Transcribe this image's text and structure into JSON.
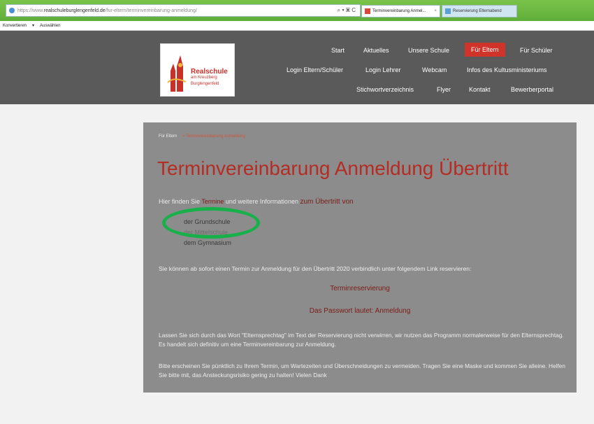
{
  "browser": {
    "url_prefix": "https://www.",
    "url_domain": "realschuleburglengenfeld.de",
    "url_path": "/fur-eltern/terminvereinbarung-anmeldung/",
    "url_tools": "⌕ ▾ ▣ C",
    "tabs": [
      {
        "label": "Terminvereinbarung Anmel...",
        "close": "×"
      },
      {
        "label": "Reservierung Elternabend"
      }
    ],
    "favbar": [
      "Konvertieren",
      "▾",
      "Auswählen"
    ]
  },
  "logo": {
    "line1": "Realschule",
    "line2": "am Kreuzberg",
    "line3": "Burglengenfeld"
  },
  "nav": {
    "row1": [
      "Start",
      "Aktuelles",
      "Unsere Schule",
      "Für Eltern",
      "Für Schüler"
    ],
    "row2": [
      "Login Eltern/Schüler",
      "Login Lehrer",
      "Webcam",
      "Infos des Kultusministeriums"
    ],
    "row3": [
      "Stichwortverzeichnis",
      "Flyer",
      "Kontakt",
      "Bewerberportal"
    ],
    "active": "Für Eltern"
  },
  "content": {
    "breadcrumb": [
      "Für Eltern",
      "> Terminvereinbarung Anmeldung"
    ],
    "title": "Terminvereinbarung Anmeldung Übertritt",
    "intro_start": "Hier finden Sie ",
    "intro_mid": "Termine",
    "intro_rest": " und weitere Informationen ",
    "intro_link": "zum Übertritt von",
    "schools": [
      "der Grundschule",
      "der Mittelschule",
      "dem Gymnasium"
    ],
    "reserve_text": "Sie können ab sofort einen Termin zur Anmeldung für den Übertritt 2020 verbindlich unter folgendem Link reservieren:",
    "reserve_link": "Terminreservierung",
    "password": "Das Passwort lautet:  Anmeldung",
    "info_text": "Lassen Sie sich durch das Wort \"Elternsprechtag\" im Text der Reservierung nicht verwirren, wir nutzen das Programm normalerweise für den Elternsprechtag. Es handelt sich definitiv um eine Terminvereinbarung zur Anmeldung.",
    "arrive_text": "Bitte erscheinen Sie pünktlich zu Ihrem Termin, um Wartezeiten und Überschneidungen zu vermeiden. Tragen Sie eine Maske und kommen Sie alleine. Helfen Sie bitte mit, das Ansteckungsrisiko gering zu halten! Vielen Dank"
  },
  "colors": {
    "header_bg": "#5a5a5a",
    "accent_red": "#d0332a",
    "panel_bg": "#8c8c8c",
    "highlight_green": "#18b04a"
  }
}
